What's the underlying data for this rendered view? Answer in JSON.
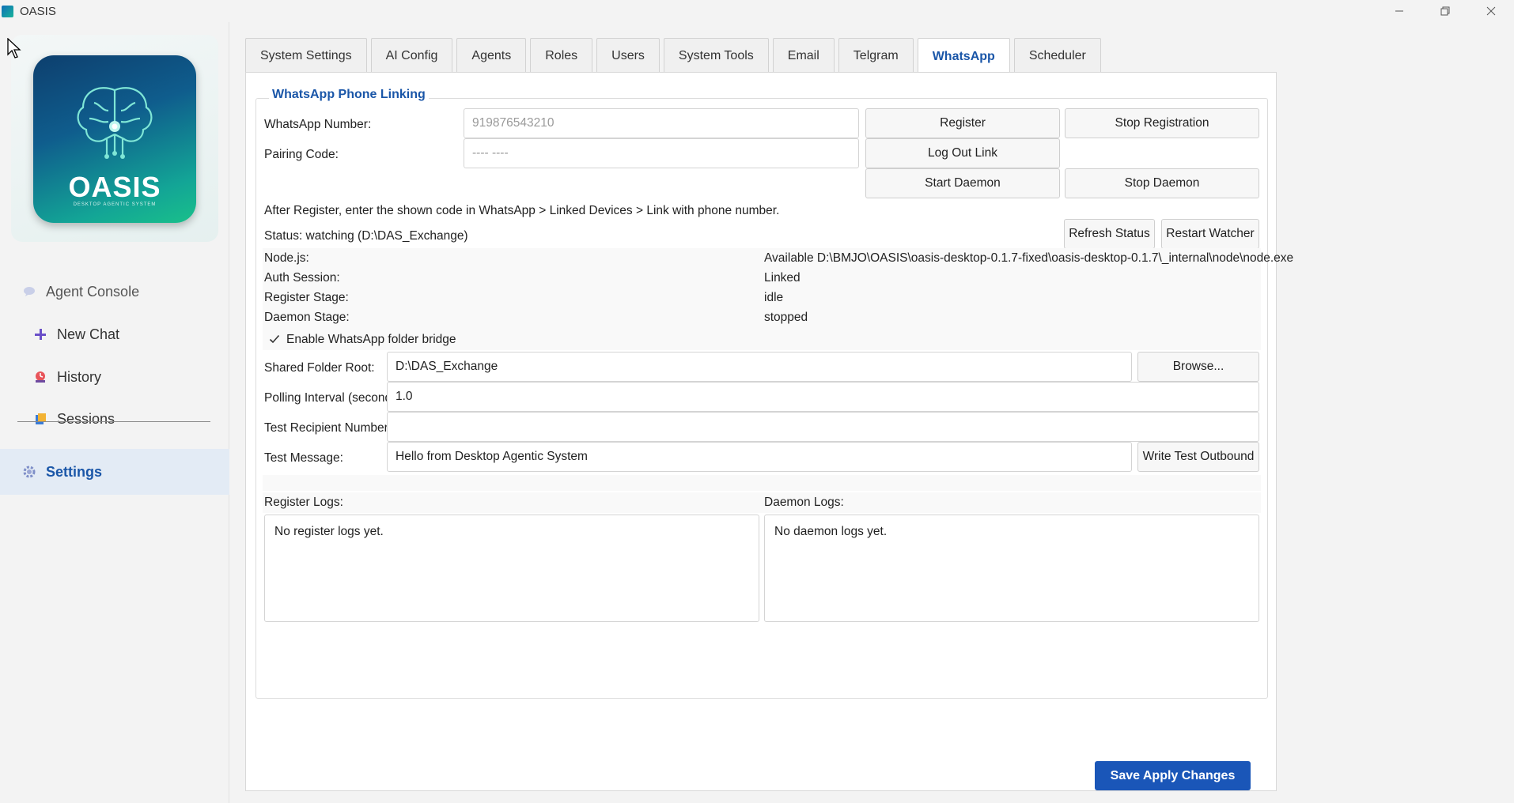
{
  "window": {
    "title": "OASIS",
    "minimize": "—",
    "restore": "❐",
    "close": "✕"
  },
  "logo": {
    "word": "OASIS",
    "subtitle": "DESKTOP AGENTIC SYSTEM"
  },
  "sidebar": {
    "agent_console": "Agent Console",
    "new_chat": "New Chat",
    "history": "History",
    "sessions": "Sessions",
    "settings": "Settings"
  },
  "tabs": [
    "System Settings",
    "AI Config",
    "Agents",
    "Roles",
    "Users",
    "System Tools",
    "Email",
    "Telgram",
    "WhatsApp",
    "Scheduler"
  ],
  "active_tab": "WhatsApp",
  "whatsapp": {
    "group_title": "WhatsApp Phone Linking",
    "number_label": "WhatsApp Number:",
    "number_placeholder": "919876543210",
    "pairing_label": "Pairing Code:",
    "pairing_placeholder": "---- ----",
    "register_btn": "Register",
    "stop_registration_btn": "Stop Registration",
    "logout_btn": "Log Out Link",
    "start_daemon_btn": "Start Daemon",
    "stop_daemon_btn": "Stop Daemon",
    "instructions": "After Register, enter the shown code in WhatsApp > Linked Devices > Link with phone number.",
    "status": "Status: watching (D:\\DAS_Exchange)",
    "refresh_btn": "Refresh Status",
    "restart_btn": "Restart Watcher",
    "info": [
      {
        "label": "Node.js:",
        "value": "Available D:\\BMJO\\OASIS\\oasis-desktop-0.1.7-fixed\\oasis-desktop-0.1.7\\_internal\\node\\node.exe"
      },
      {
        "label": "Auth Session:",
        "value": "Linked"
      },
      {
        "label": "Register Stage:",
        "value": "idle"
      },
      {
        "label": "Daemon Stage:",
        "value": "stopped"
      }
    ],
    "bridge_label": "Enable WhatsApp folder bridge",
    "bridge_checked": true,
    "shared_label": "Shared Folder Root:",
    "shared_value": "D:\\DAS_Exchange",
    "browse_btn": "Browse...",
    "polling_label": "Polling Interval (seconds):",
    "polling_value": "1.0",
    "recipient_label": "Test Recipient Number:",
    "recipient_value": "",
    "message_label": "Test Message:",
    "message_value": "Hello from Desktop Agentic System",
    "write_btn": "Write Test Outbound",
    "register_logs_label": "Register Logs:",
    "register_logs": "No register logs yet.",
    "daemon_logs_label": "Daemon Logs:",
    "daemon_logs": "No daemon logs yet."
  },
  "save_btn": "Save  Apply Changes"
}
